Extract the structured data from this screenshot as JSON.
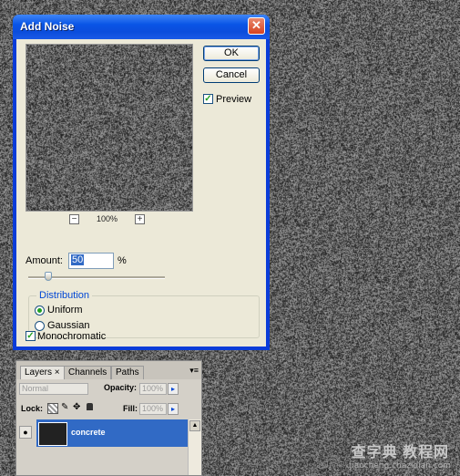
{
  "dialog": {
    "title": "Add Noise",
    "close_glyph": "✕",
    "ok_label": "OK",
    "cancel_label": "Cancel",
    "preview_label": "Preview",
    "preview_checked": true,
    "zoom_minus": "−",
    "zoom_plus": "+",
    "zoom_level": "100%",
    "amount_label": "Amount:",
    "amount_value": "50",
    "amount_unit": "%",
    "distribution_title": "Distribution",
    "uniform_label": "Uniform",
    "gaussian_label": "Gaussian",
    "selected_distribution": "Uniform",
    "monochromatic_label": "Monochromatic",
    "monochromatic_checked": true,
    "check_glyph": "✓"
  },
  "layers_panel": {
    "tabs": [
      "Layers",
      "Channels",
      "Paths"
    ],
    "tab_close": "×",
    "blend_mode": "Normal",
    "opacity_label": "Opacity:",
    "opacity_value": "100%",
    "lock_label": "Lock:",
    "fill_label": "Fill:",
    "fill_value": "100%",
    "arrow_glyph": "▸",
    "layer_name": "concrete",
    "eye_glyph": "👁"
  },
  "watermark": {
    "main": "查字典 教程网",
    "sub": "jiaocheng.chazidian.com"
  },
  "colors": {
    "title_bar": "#0a55e6",
    "dialog_bg": "#ece9d8",
    "selection": "#316ac5",
    "background": "#1a1a1a"
  }
}
